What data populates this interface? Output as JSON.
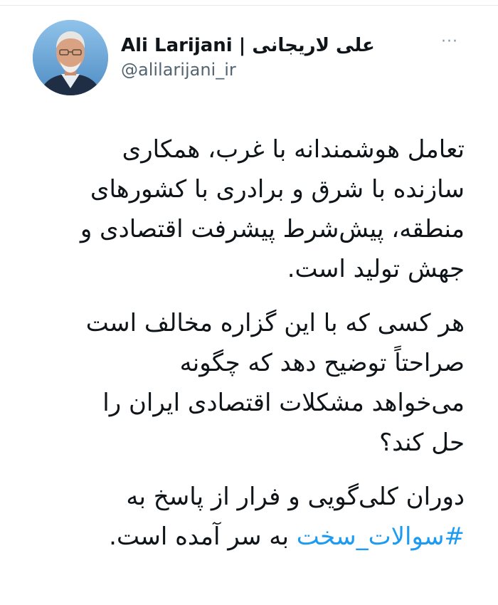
{
  "tweet": {
    "author": {
      "display_name": "Ali Larijani | علی لاریجانی",
      "handle": "@alilarijani_ir",
      "avatar_icon": "profile-photo"
    },
    "more_label": "···",
    "paragraphs": [
      {
        "lines": [
          "تعامل هوشمندانه با غرب، همکاری",
          "سازنده با شرق و برادری با کشورهای",
          "منطقه، پیش‌شرط پیشرفت اقتصادی و",
          "جهش تولید است."
        ]
      },
      {
        "lines": [
          "هر کسی که با این گزاره مخالف است",
          "صراحتاً توضیح دهد که چگونه",
          "می‌خواهد مشکلات اقتصادی ایران را",
          "حل کند؟"
        ]
      },
      {
        "lines": [
          "دوران کلی‌گویی و فرار از پاسخ به"
        ],
        "last_line": {
          "hashtag": "#سوالات_سخت",
          "text": " به سر آمده است."
        }
      }
    ],
    "colors": {
      "text": "#0f1419",
      "secondary": "#536471",
      "link": "#1d9bf0"
    }
  }
}
